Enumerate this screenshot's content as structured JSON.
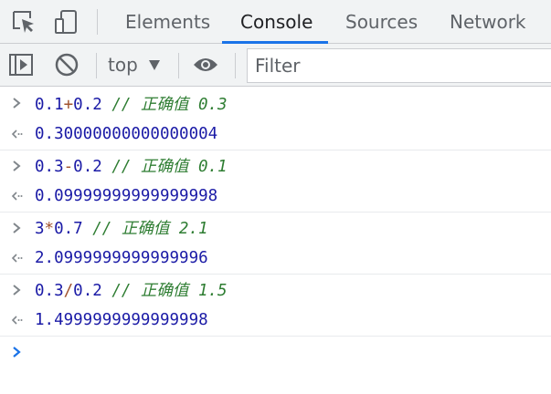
{
  "tabs": {
    "inspect_icon": "inspect-element-icon",
    "device_icon": "device-toolbar-icon",
    "items": [
      {
        "label": "Elements",
        "active": false
      },
      {
        "label": "Console",
        "active": true
      },
      {
        "label": "Sources",
        "active": false
      },
      {
        "label": "Network",
        "active": false
      }
    ]
  },
  "toolbar": {
    "sidebar_icon": "show-console-sidebar-icon",
    "clear_icon": "clear-console-icon",
    "context": "top",
    "eye_icon": "live-expression-eye-icon",
    "filter_placeholder": "Filter"
  },
  "console": {
    "entries": [
      {
        "input": {
          "a": "0.1",
          "op": "+",
          "b": "0.2",
          "comment": "// 正确值 ",
          "expected": "0.3"
        },
        "output": "0.30000000000000004"
      },
      {
        "input": {
          "a": "0.3",
          "op": "-",
          "b": "0.2",
          "comment": "// 正确值 ",
          "expected": "0.1"
        },
        "output": "0.09999999999999998"
      },
      {
        "input": {
          "a": "3",
          "op": "*",
          "b": "0.7",
          "comment": "// 正确值 ",
          "expected": "2.1"
        },
        "output": "2.0999999999999996"
      },
      {
        "input": {
          "a": "0.3",
          "op": "/",
          "b": "0.2",
          "comment": "// 正确值 ",
          "expected": "1.5"
        },
        "output": "1.4999999999999998"
      }
    ]
  },
  "colors": {
    "accent": "#1a73e8",
    "number": "#1a1aa6",
    "operator": "#a0522d",
    "comment": "#2e7d32"
  }
}
